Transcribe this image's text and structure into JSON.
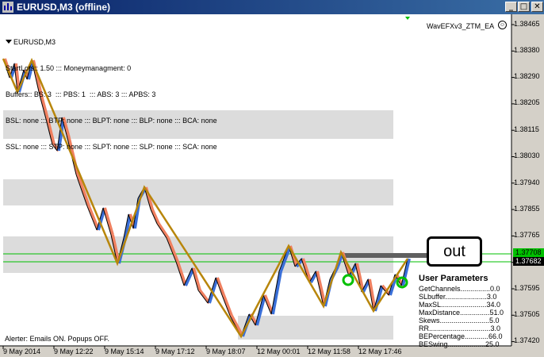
{
  "window": {
    "title": "EURUSD,M3 (offline)",
    "minimize_glyph": "_",
    "maximize_glyph": "□",
    "close_glyph": "✕"
  },
  "chart": {
    "symbol_label": "EURUSD,M3",
    "info_lines": [
      "StartLots:: 1.50 ::: Moneymanagment: 0",
      "Buffers:: BS: 3  ::: PBS: 1  ::: ABS: 3 ::: APBS: 3",
      "BSL: none ::: BTP: none ::: BLPT: none ::: BLP: none ::: BCA: none",
      "SSL: none ::: STP: none ::: SLPT: none ::: SLP: none ::: SCA: none"
    ],
    "ea_name": "WavEFXv3_ZTM_EA",
    "alerter": "Alerter:  Emails ON.  Popups OFF.",
    "callout": "out",
    "params_title": "User Parameters",
    "params": [
      "GetChannels...............0.0",
      "SLbuffer.....................3.0",
      "MaxSL.......................34.0",
      "MaxDistance...............51.0",
      "Skews.........................5.0",
      "RR...............................3.0",
      "BEPercentage............66.0",
      "BESwing...................25.0"
    ],
    "price_axis": [
      "1.38465",
      "1.38380",
      "1.38290",
      "1.38205",
      "1.38115",
      "1.38030",
      "1.37940",
      "1.37855",
      "1.37765",
      "1.37680",
      "1.37595",
      "1.37505",
      "1.37420"
    ],
    "price_tags": [
      {
        "text": "1.37708",
        "bg": "#00c000",
        "fg": "#000000"
      },
      {
        "text": "1.37682",
        "bg": "#000000",
        "fg": "#ffffff"
      }
    ],
    "time_axis": [
      "9 May 2014",
      "9 May 12:22",
      "9 May 15:14",
      "9 May 17:12",
      "9 May 18:07",
      "12 May 00:01",
      "12 May 11:58",
      "12 May 17:46"
    ],
    "colors": {
      "zigzag": "#b8860b",
      "bull": "#3a6fd8",
      "bear": "#f08060",
      "green_line": "#00c000",
      "zone": "#dcdcdc"
    }
  }
}
